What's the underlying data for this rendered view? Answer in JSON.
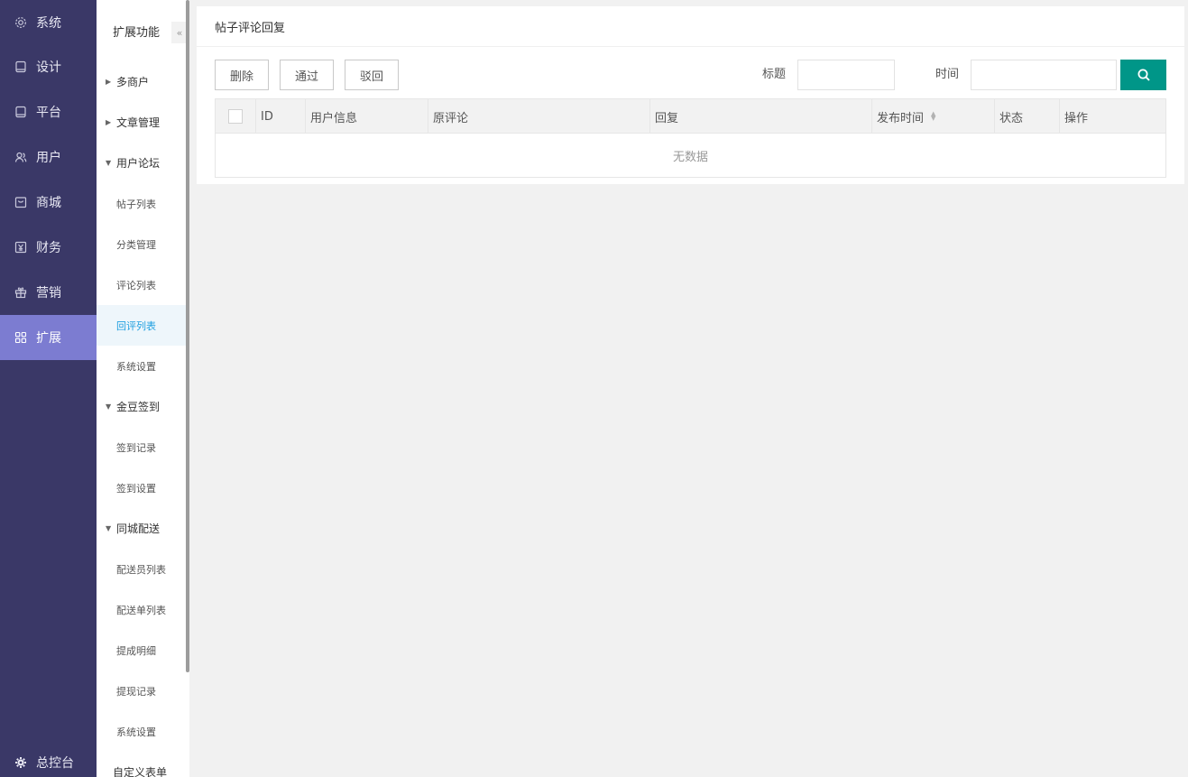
{
  "nav": {
    "items": [
      {
        "label": "系统",
        "icon": "gear-icon"
      },
      {
        "label": "设计",
        "icon": "tablet-icon"
      },
      {
        "label": "平台",
        "icon": "tablet-icon"
      },
      {
        "label": "用户",
        "icon": "users-icon"
      },
      {
        "label": "商城",
        "icon": "shop-icon"
      },
      {
        "label": "财务",
        "icon": "finance-icon"
      },
      {
        "label": "营销",
        "icon": "gift-icon"
      },
      {
        "label": "扩展",
        "icon": "grid-icon"
      }
    ],
    "active_index": 7,
    "bottom_label": "总控台"
  },
  "sub": {
    "title": "扩展功能",
    "collapse_glyph": "«",
    "groups": [
      {
        "label": "多商户",
        "expanded": false,
        "items": []
      },
      {
        "label": "文章管理",
        "expanded": false,
        "items": []
      },
      {
        "label": "用户论坛",
        "expanded": true,
        "items": [
          "帖子列表",
          "分类管理",
          "评论列表",
          "回评列表",
          "系统设置"
        ]
      },
      {
        "label": "金豆签到",
        "expanded": true,
        "items": [
          "签到记录",
          "签到设置"
        ]
      },
      {
        "label": "同城配送",
        "expanded": true,
        "items": [
          "配送员列表",
          "配送单列表",
          "提成明细",
          "提现记录",
          "系统设置"
        ]
      },
      {
        "label": "自定义表单",
        "expanded": false,
        "items": []
      }
    ],
    "active_item": "回评列表"
  },
  "page": {
    "title": "帖子评论回复",
    "buttons": {
      "delete": "删除",
      "approve": "通过",
      "reject": "驳回"
    },
    "filters": {
      "title_label": "标题",
      "title_value": "",
      "time_label": "时间",
      "time_value": ""
    },
    "table": {
      "columns": [
        "ID",
        "用户信息",
        "原评论",
        "回复",
        "发布时间",
        "状态",
        "操作"
      ],
      "empty_text": "无数据"
    }
  },
  "colors": {
    "nav_bg": "#3a3867",
    "nav_active": "#7c7cd1",
    "search_button": "#009688",
    "active_sub_text": "#1e9fe0"
  }
}
